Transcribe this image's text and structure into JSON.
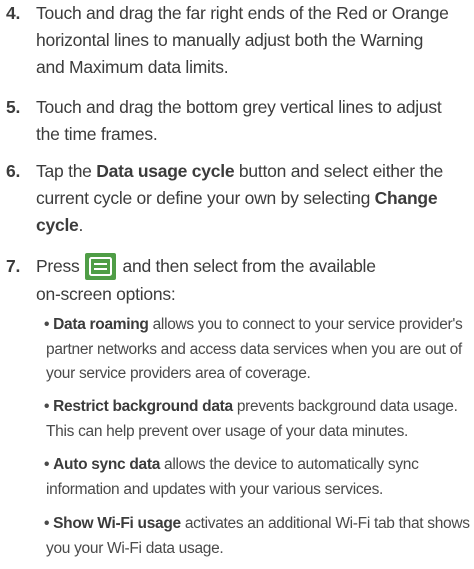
{
  "steps": {
    "s4": {
      "num": "4.",
      "line1": "Touch and drag the far right ends of the Red or Orange",
      "line2": "horizontal lines to manually adjust both the Warning",
      "line3": "and Maximum data limits."
    },
    "s5": {
      "num": "5.",
      "line1": "Touch and drag the bottom grey vertical lines to adjust",
      "line2": "the time frames."
    },
    "s6": {
      "num": "6.",
      "pre": "Tap the ",
      "bold1": "Data usage cycle",
      "mid1": " button and select either the",
      "line2_pre": "current cycle or define your own by selecting ",
      "bold2": "Change",
      "line3_bold": "cycle",
      "line3_post": "."
    },
    "s7": {
      "num": "7.",
      "pre": "Press",
      "post": "and then select from the available",
      "line2": "on-screen options:"
    }
  },
  "icon": {
    "name": "menu-icon",
    "color": "#4f9d46"
  },
  "bullets": [
    {
      "term": "Data roaming",
      "line1": " allows you to connect to your service provider's",
      "line2": "partner networks and access data services when you are out of",
      "line3": "your service providers area of coverage."
    },
    {
      "term": "Restrict background data",
      "line1": " prevents background data usage.",
      "line2": "This can help prevent over usage of your data minutes."
    },
    {
      "term": "Auto sync data",
      "line1": " allows the device to automatically sync",
      "line2": "information and updates with your various services."
    },
    {
      "term": "Show Wi-Fi usage",
      "line1": " activates an additional Wi-Fi tab that shows",
      "line2": "you your Wi-Fi data usage."
    }
  ]
}
